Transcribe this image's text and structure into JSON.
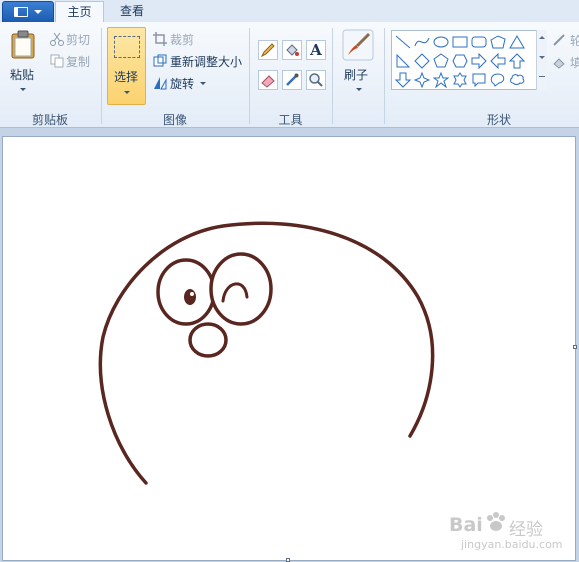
{
  "tabs": [
    {
      "label": "主页",
      "active": true
    },
    {
      "label": "查看",
      "active": false
    }
  ],
  "clipboard": {
    "paste_label": "粘贴",
    "cut_label": "剪切",
    "copy_label": "复制",
    "group_label": "剪贴板"
  },
  "image": {
    "select_label": "选择",
    "crop_label": "裁剪",
    "resize_label": "重新调整大小",
    "rotate_label": "旋转",
    "group_label": "图像"
  },
  "tools": {
    "group_label": "工具",
    "icons": [
      "pencil-icon",
      "fill-bucket-icon",
      "text-icon",
      "eraser-icon",
      "color-picker-icon",
      "magnifier-icon"
    ]
  },
  "brushes": {
    "label": "刷子"
  },
  "shapes": {
    "group_label": "形状",
    "items": [
      "line",
      "curve",
      "oval",
      "rectangle",
      "rounded-rectangle",
      "polygon",
      "triangle",
      "right-triangle",
      "diamond",
      "pentagon",
      "hexagon",
      "right-arrow",
      "left-arrow",
      "up-arrow",
      "down-arrow",
      "four-point-star",
      "five-point-star",
      "six-point-star",
      "rounded-callout",
      "oval-callout",
      "cloud-callout"
    ],
    "outline_label_partial": "轮",
    "fill_label_partial": "填"
  },
  "watermark": {
    "brand": "Bai",
    "brand_cn": "经验",
    "url": "jingyan.baidu.com"
  },
  "colors": {
    "stroke": "#5a2620",
    "accent": "#2b6fc2",
    "ribbon_text": "#1e395b"
  }
}
